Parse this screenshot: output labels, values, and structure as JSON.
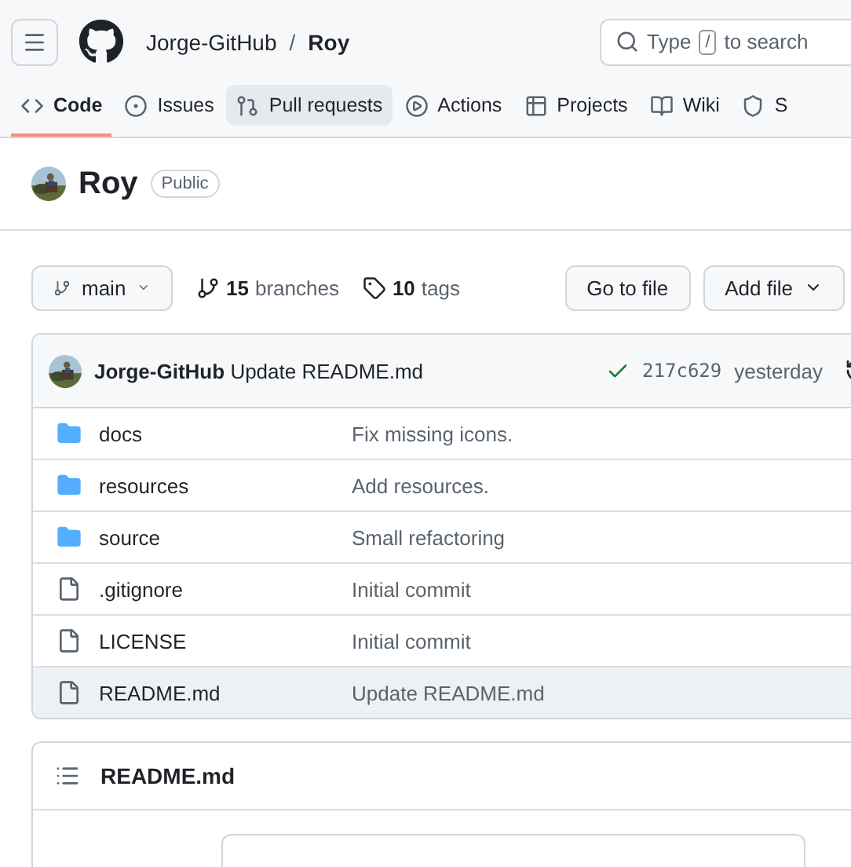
{
  "header": {
    "owner": "Jorge-GitHub",
    "separator": "/",
    "repo": "Roy",
    "search": {
      "before": "Type",
      "key": "/",
      "after": "to search"
    }
  },
  "tabs": [
    {
      "label": "Code",
      "selected": true,
      "highlighted": false
    },
    {
      "label": "Issues",
      "selected": false,
      "highlighted": false
    },
    {
      "label": "Pull requests",
      "selected": false,
      "highlighted": true
    },
    {
      "label": "Actions",
      "selected": false,
      "highlighted": false
    },
    {
      "label": "Projects",
      "selected": false,
      "highlighted": false
    },
    {
      "label": "Wiki",
      "selected": false,
      "highlighted": false
    },
    {
      "label": "S",
      "selected": false,
      "highlighted": false
    }
  ],
  "repo": {
    "name": "Roy",
    "visibility": "Public"
  },
  "branch_bar": {
    "branch": "main",
    "branches_count": "15",
    "branches_label": "branches",
    "tags_count": "10",
    "tags_label": "tags",
    "buttons": [
      "Go to file",
      "Add file"
    ]
  },
  "latest_commit": {
    "author": "Jorge-GitHub",
    "message": "Update README.md",
    "sha": "217c629",
    "time": "yesterday"
  },
  "files": [
    {
      "name": "docs",
      "kind": "folder",
      "message": "Fix missing icons.",
      "highlighted": false
    },
    {
      "name": "resources",
      "kind": "folder",
      "message": "Add resources.",
      "highlighted": false
    },
    {
      "name": "source",
      "kind": "folder",
      "message": "Small refactoring",
      "highlighted": false
    },
    {
      "name": ".gitignore",
      "kind": "file",
      "message": "Initial commit",
      "highlighted": false
    },
    {
      "name": "LICENSE",
      "kind": "file",
      "message": "Initial commit",
      "highlighted": false
    },
    {
      "name": "README.md",
      "kind": "file",
      "message": "Update README.md",
      "highlighted": true
    }
  ],
  "readme": {
    "title": "README.md"
  }
}
